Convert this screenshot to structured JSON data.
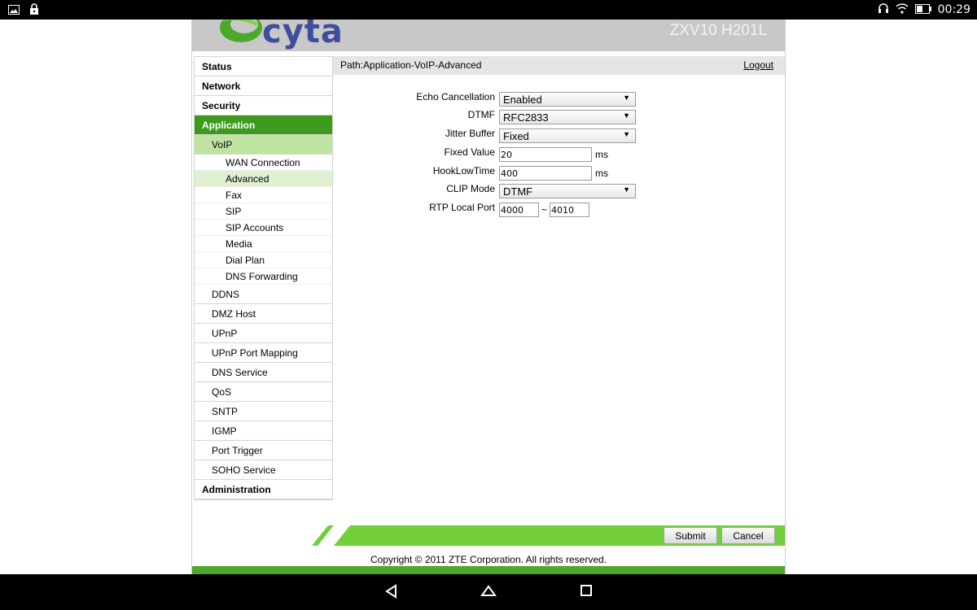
{
  "status_bar": {
    "time": "00:29"
  },
  "header": {
    "logo_text": "cyta",
    "model": "ZXV10 H201L"
  },
  "sidebar": {
    "items": [
      {
        "label": "Status",
        "level": "top"
      },
      {
        "label": "Network",
        "level": "top"
      },
      {
        "label": "Security",
        "level": "top"
      },
      {
        "label": "Application",
        "level": "top",
        "active": true
      },
      {
        "label": "VoIP",
        "level": "sub",
        "active": true
      },
      {
        "label": "WAN Connection",
        "level": "sub2"
      },
      {
        "label": "Advanced",
        "level": "sub2",
        "active": true
      },
      {
        "label": "Fax",
        "level": "sub2"
      },
      {
        "label": "SIP",
        "level": "sub2"
      },
      {
        "label": "SIP Accounts",
        "level": "sub2"
      },
      {
        "label": "Media",
        "level": "sub2"
      },
      {
        "label": "Dial Plan",
        "level": "sub2"
      },
      {
        "label": "DNS Forwarding",
        "level": "sub2"
      },
      {
        "label": "DDNS",
        "level": "sub"
      },
      {
        "label": "DMZ Host",
        "level": "sub"
      },
      {
        "label": "UPnP",
        "level": "sub"
      },
      {
        "label": "UPnP Port Mapping",
        "level": "sub"
      },
      {
        "label": "DNS Service",
        "level": "sub"
      },
      {
        "label": "QoS",
        "level": "sub"
      },
      {
        "label": "SNTP",
        "level": "sub"
      },
      {
        "label": "IGMP",
        "level": "sub"
      },
      {
        "label": "Port Trigger",
        "level": "sub"
      },
      {
        "label": "SOHO Service",
        "level": "sub"
      },
      {
        "label": "Administration",
        "level": "top"
      }
    ]
  },
  "content": {
    "path": "Path:Application-VoIP-Advanced",
    "logout": "Logout",
    "fields": {
      "echo_cancellation": {
        "label": "Echo Cancellation",
        "value": "Enabled"
      },
      "dtmf": {
        "label": "DTMF",
        "value": "RFC2833"
      },
      "jitter_buffer": {
        "label": "Jitter Buffer",
        "value": "Fixed"
      },
      "fixed_value": {
        "label": "Fixed Value",
        "value": "20",
        "unit": "ms"
      },
      "hooklowtime": {
        "label": "HookLowTime",
        "value": "400",
        "unit": "ms"
      },
      "clip_mode": {
        "label": "CLIP Mode",
        "value": "DTMF"
      },
      "rtp_local_port": {
        "label": "RTP Local Port",
        "from": "4000",
        "separator": "~",
        "to": "4010"
      }
    }
  },
  "footer": {
    "submit": "Submit",
    "cancel": "Cancel",
    "copyright": "Copyright © 2011 ZTE Corporation. All rights reserved."
  },
  "colors": {
    "accent_green": "#3d9a1c",
    "footer_green": "#72cf3a"
  }
}
